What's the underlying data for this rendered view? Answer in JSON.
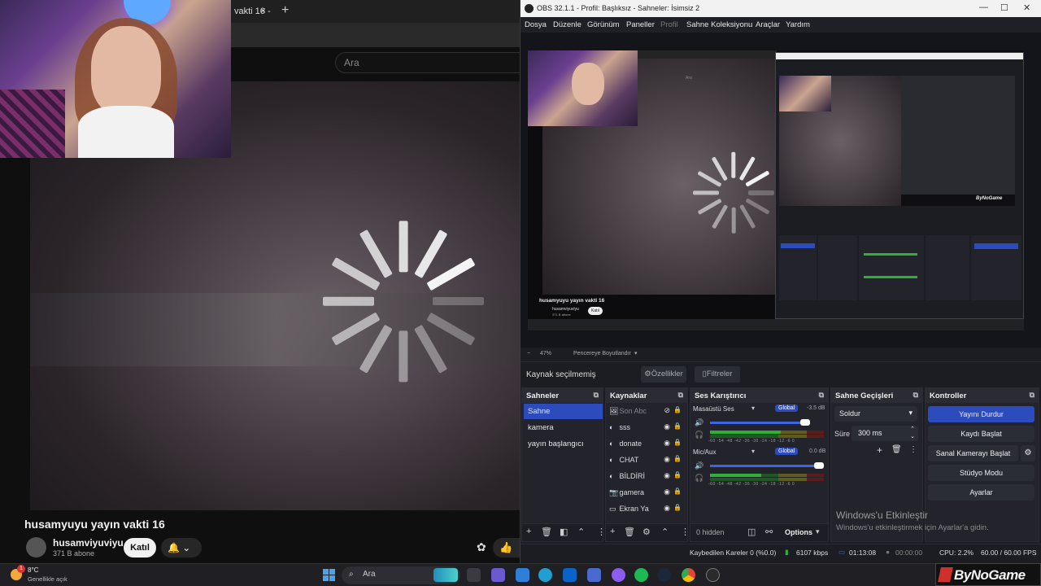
{
  "youtube": {
    "tab_title": "vakti 16 -",
    "tab_close": "×",
    "new_tab": "+",
    "search_placeholder": "Ara",
    "video_title": "husamyuyu yayın vakti 16",
    "channel_name": "husamviyuviyu",
    "subscribers": "371 B abone",
    "join_label": "Katıl",
    "bell_label": "🔔 ⌄",
    "like_label": "👍"
  },
  "obs": {
    "window_title": "OBS 32.1.1 - Profil: Başlıksız - Sahneler: İsimsiz 2",
    "window_buttons": [
      "—",
      "☐",
      "✕"
    ],
    "menu": [
      "Dosya",
      "Düzenle",
      "Görünüm",
      "Paneller",
      "Profil",
      "Sahne Koleksiyonu",
      "Araçlar",
      "Yardım"
    ],
    "zoom": {
      "minus": "−",
      "level": "47%",
      "resize_label": "Pencereye Boyutlandır",
      "dropdown": "▾"
    },
    "source_bar": {
      "none_selected": "Kaynak seçilmemiş",
      "properties": "Özellikler",
      "filters": "Filtreler"
    },
    "scenes": {
      "title": "Sahneler",
      "items": [
        "Sahne",
        "kamera",
        "yayın başlangıcı"
      ],
      "selected_index": 0
    },
    "sources": {
      "title": "Kaynaklar",
      "items": [
        {
          "icon": "🖼",
          "label": "Son Abc",
          "hidden": true
        },
        {
          "icon": "◐",
          "label": "sss",
          "hidden": false
        },
        {
          "icon": "◐",
          "label": "donate",
          "hidden": false
        },
        {
          "icon": "◐",
          "label": "CHAT",
          "hidden": false
        },
        {
          "icon": "◐",
          "label": "BİLDİRİ",
          "hidden": false
        },
        {
          "icon": "📷",
          "label": "gamera",
          "hidden": false
        },
        {
          "icon": "▭",
          "label": "Ekran Ya",
          "hidden": false
        }
      ]
    },
    "mixer": {
      "title": "Ses Karıştırıcı",
      "channels": [
        {
          "name": "Masaüstü Ses",
          "badge": "Global",
          "db": "-3.5 dB",
          "volume": 0.88,
          "level": 0.62
        },
        {
          "name": "Mic/Aux",
          "badge": "Global",
          "db": "0.0 dB",
          "volume": 1.0,
          "level": 0.45
        }
      ],
      "ticks": "-60 -54 -48 -42 -36 -30 -24 -18 -12 -6 0",
      "footer_hidden": "0 hidden",
      "footer_options": "Options"
    },
    "transitions": {
      "title": "Sahne Geçişleri",
      "type": "Soldur",
      "duration_label": "Süre",
      "duration": "300 ms"
    },
    "controls": {
      "title": "Kontroller",
      "buttons": [
        "Yayını Durdur",
        "Kaydı Başlat",
        "Sanal Kamerayı Başlat",
        "Stüdyo Modu",
        "Ayarlar"
      ]
    },
    "status": {
      "dropped_frames": "Kaybedilen Kareler 0 (%0.0)",
      "bitrate": "6107 kbps",
      "stream_time": "01:13:08",
      "record_time": "00:00:00",
      "cpu": "CPU: 2.2%",
      "fps": "60.00 / 60.00 FPS"
    },
    "activate_windows": {
      "title": "Windows'u Etkinleştir",
      "subtitle": "Windows'u etkinleştirmek için Ayarlar'a gidin."
    },
    "preview_nested": {
      "video_title": "husamyuyu yayın vakti 16",
      "channel": "husamviyuviyu",
      "subs": "371 B abone",
      "join": "Katıl",
      "search": "Ara",
      "logo": "ByNoGame"
    }
  },
  "taskbar": {
    "weather_temp": "8°C",
    "weather_desc": "Genellikle açık",
    "notification_count": "1",
    "search_placeholder": "Ara"
  },
  "overlay_logo": "ByNoGame",
  "colors": {
    "obs_accent": "#2c4bbd",
    "meter_green": "#2fae3a",
    "meter_yellow": "#c8c236",
    "meter_red": "#b23535"
  }
}
